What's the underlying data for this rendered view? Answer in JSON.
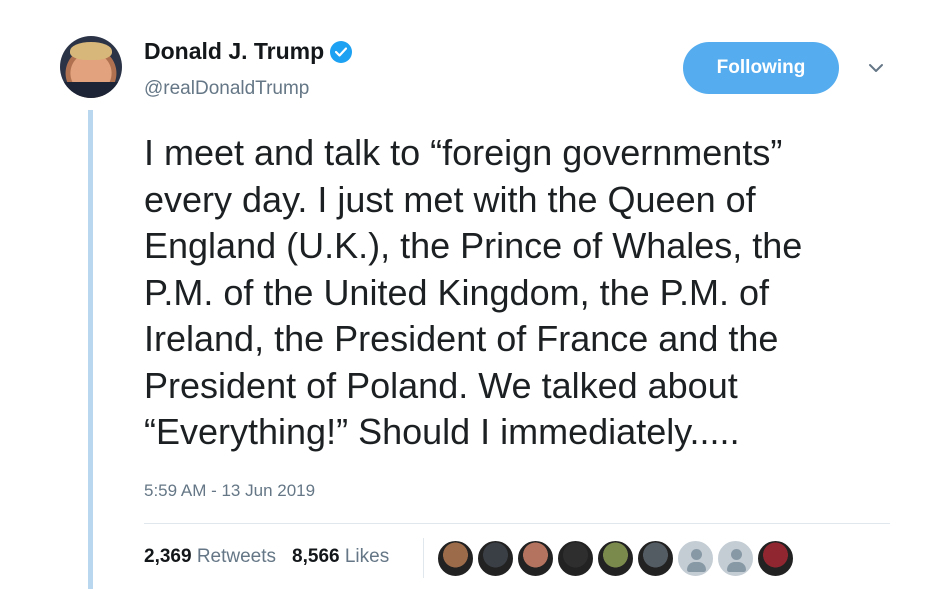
{
  "author": {
    "name": "Donald J. Trump",
    "handle": "@realDonaldTrump",
    "verified": true,
    "avatar_icon": "profile-photo"
  },
  "follow_button": {
    "label": "Following",
    "color": "#55acee"
  },
  "menu_icon": "chevron-down-icon",
  "tweet": {
    "lines": [
      "I meet and talk to “foreign governments”",
      "every day. I just met with the Queen of",
      "England (U.K.), the Prince of Whales, the",
      "P.M. of the United Kingdom, the P.M. of",
      "Ireland, the President of France and the",
      "President of Poland. We talked about",
      "“Everything!” Should I immediately....."
    ],
    "timestamp": "5:59 AM - 13 Jun 2019"
  },
  "stats": {
    "retweets_count": "2,369",
    "retweets_label": "Retweets",
    "likes_count": "8,566",
    "likes_label": "Likes"
  },
  "likers": [
    {
      "icon": "liker-avatar-1",
      "color": "#9b6b4a"
    },
    {
      "icon": "liker-avatar-2",
      "color": "#3a3f45"
    },
    {
      "icon": "liker-avatar-3",
      "color": "#b4735e"
    },
    {
      "icon": "liker-avatar-4",
      "color": "#2e2e2e"
    },
    {
      "icon": "liker-avatar-5",
      "color": "#7a8a4c"
    },
    {
      "icon": "liker-avatar-6",
      "color": "#545c63"
    },
    {
      "icon": "default-avatar",
      "color": "#c4cdd4"
    },
    {
      "icon": "default-avatar",
      "color": "#c4cdd4"
    },
    {
      "icon": "liker-avatar-9",
      "color": "#8f2630"
    }
  ],
  "colors": {
    "accent": "#1da1f2",
    "thread_line": "#b9d7ef",
    "secondary_text": "#657786"
  }
}
